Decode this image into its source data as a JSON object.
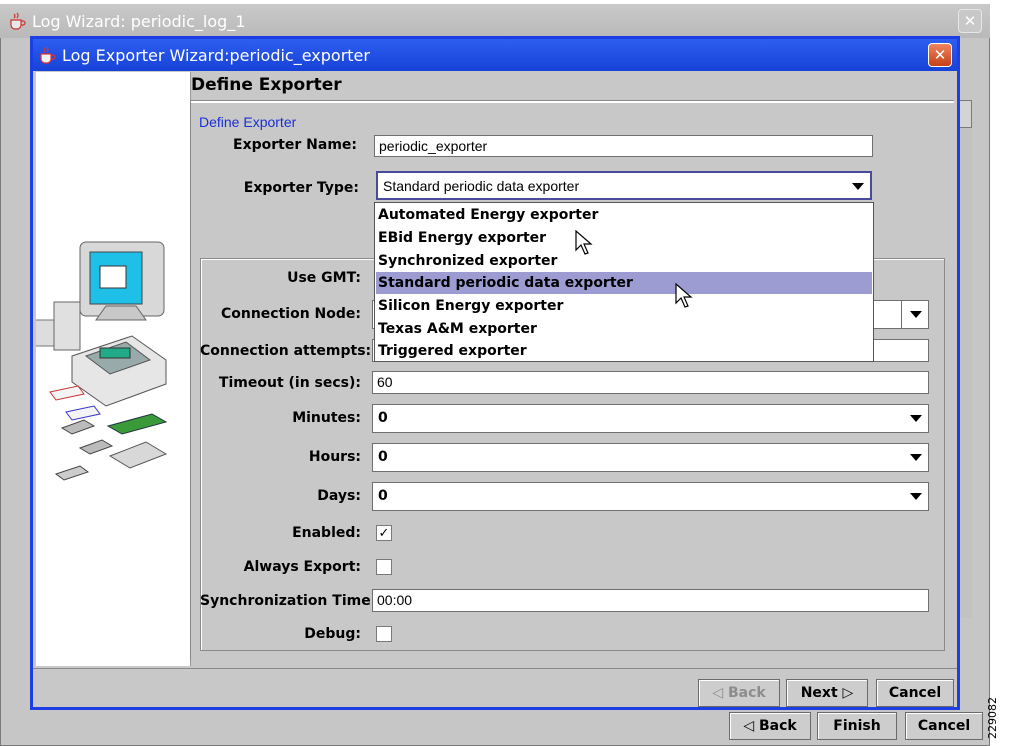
{
  "outer_window": {
    "title": "Log Wizard: periodic_log_1",
    "buttons": {
      "back": "◁ Back",
      "finish": "Finish",
      "cancel": "Cancel"
    }
  },
  "dialog": {
    "title": "Log Exporter Wizard:periodic_exporter",
    "heading": "Define Exporter",
    "section": "Define Exporter",
    "fields": {
      "exporter_name": {
        "label": "Exporter Name:",
        "value": "periodic_exporter"
      },
      "exporter_type": {
        "label": "Exporter Type:",
        "value": "Standard periodic data exporter"
      },
      "use_gmt": {
        "label": "Use GMT:"
      },
      "connection_node": {
        "label": "Connection Node:"
      },
      "connection_attempts": {
        "label": "Connection attempts:"
      },
      "timeout": {
        "label": "Timeout (in secs):",
        "value": "60"
      },
      "minutes": {
        "label": "Minutes:",
        "value": "0"
      },
      "hours": {
        "label": "Hours:",
        "value": "0"
      },
      "days": {
        "label": "Days:",
        "value": "0"
      },
      "enabled": {
        "label": "Enabled:",
        "checked": true
      },
      "always_export": {
        "label": "Always Export:",
        "checked": false
      },
      "sync_time": {
        "label": "Synchronization Time:",
        "value": "00:00"
      },
      "debug": {
        "label": "Debug:",
        "checked": false
      }
    },
    "dropdown": {
      "items": [
        "Automated Energy exporter",
        "EBid Energy exporter",
        "Synchronized exporter",
        "Standard periodic data exporter",
        "Silicon Energy exporter",
        "Texas A&M exporter",
        "Triggered exporter"
      ],
      "selected_index": 3
    },
    "buttons": {
      "back": "◁ Back",
      "next": "Next ▷",
      "cancel": "Cancel"
    }
  },
  "figure_number": "229082",
  "colors": {
    "title_blue": "#1742d8",
    "section_blue": "#1a2fd6",
    "selection": "#9c9cd2"
  }
}
